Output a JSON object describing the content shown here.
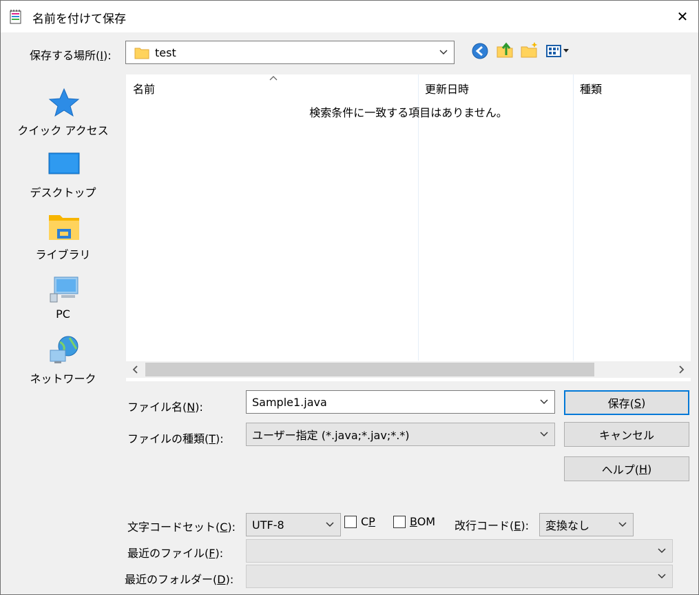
{
  "window": {
    "title": "名前を付けて保存",
    "close_glyph": "✕"
  },
  "location": {
    "label_prefix": "保存する場所(",
    "label_key": "I",
    "label_suffix": "):",
    "value": "test"
  },
  "toolbar": {
    "icons": [
      "back-icon",
      "up-folder-icon",
      "new-folder-icon",
      "view-menu-icon"
    ]
  },
  "places": [
    {
      "label": "クイック アクセス",
      "icon": "star-icon"
    },
    {
      "label": "デスクトップ",
      "icon": "desktop-icon"
    },
    {
      "label": "ライブラリ",
      "icon": "library-icon"
    },
    {
      "label": "PC",
      "icon": "computer-icon"
    },
    {
      "label": "ネットワーク",
      "icon": "network-icon"
    }
  ],
  "filelist": {
    "columns": [
      "名前",
      "更新日時",
      "種類"
    ],
    "empty_message": "検索条件に一致する項目はありません。"
  },
  "filename": {
    "label_prefix": "ファイル名(",
    "label_key": "N",
    "label_suffix": "):",
    "value": "Sample1.java"
  },
  "filetype": {
    "label_prefix": "ファイルの種類(",
    "label_key": "T",
    "label_suffix": "):",
    "value": "ユーザー指定 (*.java;*.jav;*.*)"
  },
  "buttons": {
    "save_prefix": "保存(",
    "save_key": "S",
    "save_suffix": ")",
    "cancel": "キャンセル",
    "help_prefix": "ヘルプ(",
    "help_key": "H",
    "help_suffix": ")"
  },
  "encoding": {
    "label_prefix": "文字コードセット(",
    "label_key": "C",
    "label_suffix": "):",
    "value": "UTF-8",
    "cp_prefix": "C",
    "cp_key": "P",
    "bom_key": "B",
    "bom_suffix": "OM",
    "cp_checked": false,
    "bom_checked": false
  },
  "linebreak": {
    "label_prefix": "改行コード(",
    "label_key": "E",
    "label_suffix": "):",
    "value": "変換なし"
  },
  "recent_files": {
    "label_prefix": "最近のファイル(",
    "label_key": "F",
    "label_suffix": "):"
  },
  "recent_folders": {
    "label_prefix": "最近のフォルダー(",
    "label_key": "D",
    "label_suffix": "):"
  }
}
